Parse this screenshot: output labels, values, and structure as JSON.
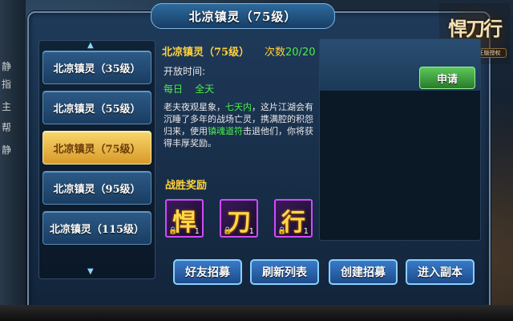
{
  "window": {
    "title": "北凉镇灵（75级）"
  },
  "logo": {
    "main": "悍刀行",
    "sub": "徐天戏谑模正版授权"
  },
  "side_text": [
    "静",
    "指",
    "主",
    "帮",
    "静"
  ],
  "list": {
    "items": [
      {
        "label": "北凉镇灵（35级）",
        "active": false
      },
      {
        "label": "北凉镇灵（55级）",
        "active": false
      },
      {
        "label": "北凉镇灵（75级）",
        "active": true
      },
      {
        "label": "北凉镇灵（95级）",
        "active": false
      },
      {
        "label": "北凉镇灵（115级）",
        "active": false
      }
    ],
    "up_arrow": "▲",
    "down_arrow": "▼"
  },
  "detail": {
    "title": "北凉镇灵（75级）",
    "count_label": "次数",
    "count_value": "20/20",
    "open_time_label": "开放时间:",
    "days": "每日    全天",
    "desc_1": "老夫夜观星象，",
    "desc_2": "七天内",
    "desc_3": "，这片江湖会有沉睡了多年的战场亡灵，携满腔的积怨归来，使用",
    "desc_4": "镇魂道符",
    "desc_5": "击退他们，你将获得丰厚奖励。",
    "reward_label": "战胜奖励",
    "rewards": [
      {
        "glyph": "悍",
        "qty": "1",
        "lock": "🔒"
      },
      {
        "glyph": "刀",
        "qty": "1",
        "lock": "🔒"
      },
      {
        "glyph": "行",
        "qty": "1",
        "lock": "🔒"
      }
    ]
  },
  "right": {
    "apply_label": "申请"
  },
  "buttons": {
    "friend_recruit": "好友招募",
    "refresh_list": "刷新列表",
    "create_recruit": "创建招募",
    "enter_dungeon": "进入副本"
  },
  "colors": {
    "accent_gold": "#ffd23a",
    "green": "#4aef4a",
    "active_item": "#f8d66a",
    "button_blue": "#2a64aa"
  }
}
